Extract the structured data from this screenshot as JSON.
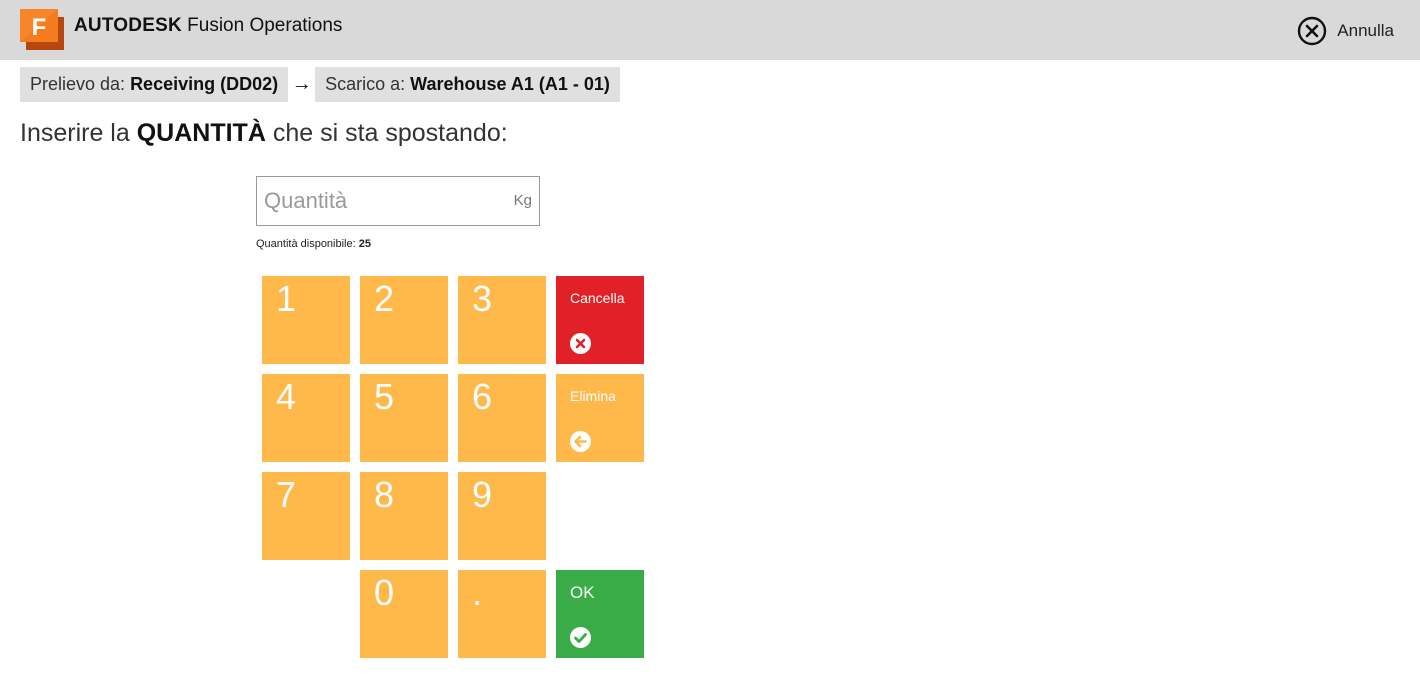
{
  "header": {
    "brand_bold": "AUTODESK",
    "brand_rest": " Fusion Operations",
    "logo_letter": "F",
    "cancel_label": "Annulla",
    "cancel_icon": "close-circle-icon"
  },
  "route": {
    "from_prefix": "Prelievo da: ",
    "from_value": "Receiving (DD02)",
    "arrow": "→",
    "to_prefix": "Scarico a: ",
    "to_value": "Warehouse A1 (A1 - 01)"
  },
  "prompt": {
    "before": "Inserire la ",
    "bold": "QUANTITÀ",
    "after": " che si sta spostando:"
  },
  "quantity": {
    "value": "",
    "placeholder": "Quantità",
    "unit": "Kg",
    "available_label": "Quantità disponibile: ",
    "available_value": "25"
  },
  "keypad": {
    "digits": [
      "1",
      "2",
      "3",
      "4",
      "5",
      "6",
      "7",
      "8",
      "9",
      "0",
      "."
    ],
    "clear": {
      "label": "Cancella",
      "icon": "close-circle-icon",
      "color": "#e12127"
    },
    "delete": {
      "label": "Elimina",
      "icon": "arrow-left-circle-icon",
      "color": "#ffb84a"
    },
    "ok": {
      "label": "OK",
      "icon": "check-circle-icon",
      "color": "#3aac47"
    },
    "key_color": "#ffb84a"
  },
  "colors": {
    "header_bg": "#d9d9d9",
    "chip_bg": "#e0e0e0",
    "brand_orange": "#f47b20"
  }
}
